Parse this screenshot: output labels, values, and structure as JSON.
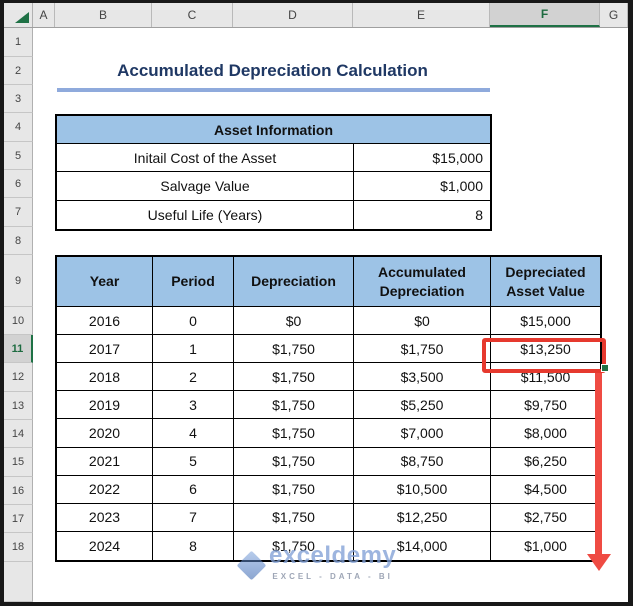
{
  "sheet": {
    "column_headers": [
      "A",
      "B",
      "C",
      "D",
      "E",
      "F",
      "G"
    ],
    "row_headers": [
      "1",
      "2",
      "3",
      "4",
      "5",
      "6",
      "7",
      "8",
      "9",
      "10",
      "11",
      "12",
      "13",
      "14",
      "15",
      "16",
      "17",
      "18"
    ],
    "selected_column": "F",
    "selected_row": "11"
  },
  "title": {
    "text": "Accumulated Depreciation Calculation"
  },
  "asset_info_table": {
    "header": "Asset Information",
    "rows": [
      {
        "label": "Initail Cost of the Asset",
        "value": "$15,000"
      },
      {
        "label": "Salvage Value",
        "value": "$1,000"
      },
      {
        "label": "Useful Life (Years)",
        "value": "8"
      }
    ]
  },
  "depreciation_table": {
    "columns": [
      "Year",
      "Period",
      "Depreciation",
      "Accumulated Depreciation",
      "Depreciated Asset Value"
    ],
    "rows": [
      [
        "2016",
        "0",
        "$0",
        "$0",
        "$15,000"
      ],
      [
        "2017",
        "1",
        "$1,750",
        "$1,750",
        "$13,250"
      ],
      [
        "2018",
        "2",
        "$1,750",
        "$3,500",
        "$11,500"
      ],
      [
        "2019",
        "3",
        "$1,750",
        "$5,250",
        "$9,750"
      ],
      [
        "2020",
        "4",
        "$1,750",
        "$7,000",
        "$8,000"
      ],
      [
        "2021",
        "5",
        "$1,750",
        "$8,750",
        "$6,250"
      ],
      [
        "2022",
        "6",
        "$1,750",
        "$10,500",
        "$4,500"
      ],
      [
        "2023",
        "7",
        "$1,750",
        "$12,250",
        "$2,750"
      ],
      [
        "2024",
        "8",
        "$1,750",
        "$14,000",
        "$1,000"
      ]
    ],
    "highlighted_value": "$13,250"
  },
  "watermark": {
    "brand": "exceldemy",
    "tagline": "EXCEL - DATA - BI"
  },
  "colors": {
    "table_header_blue": "#9DC3E6",
    "title_text": "#1F3864",
    "title_underline": "#8FAADC",
    "annotation_red": "#E6392E",
    "excel_green": "#1E7145",
    "header_gray": "#E7E7E7",
    "selected_header_gray": "#D2D2D2"
  }
}
